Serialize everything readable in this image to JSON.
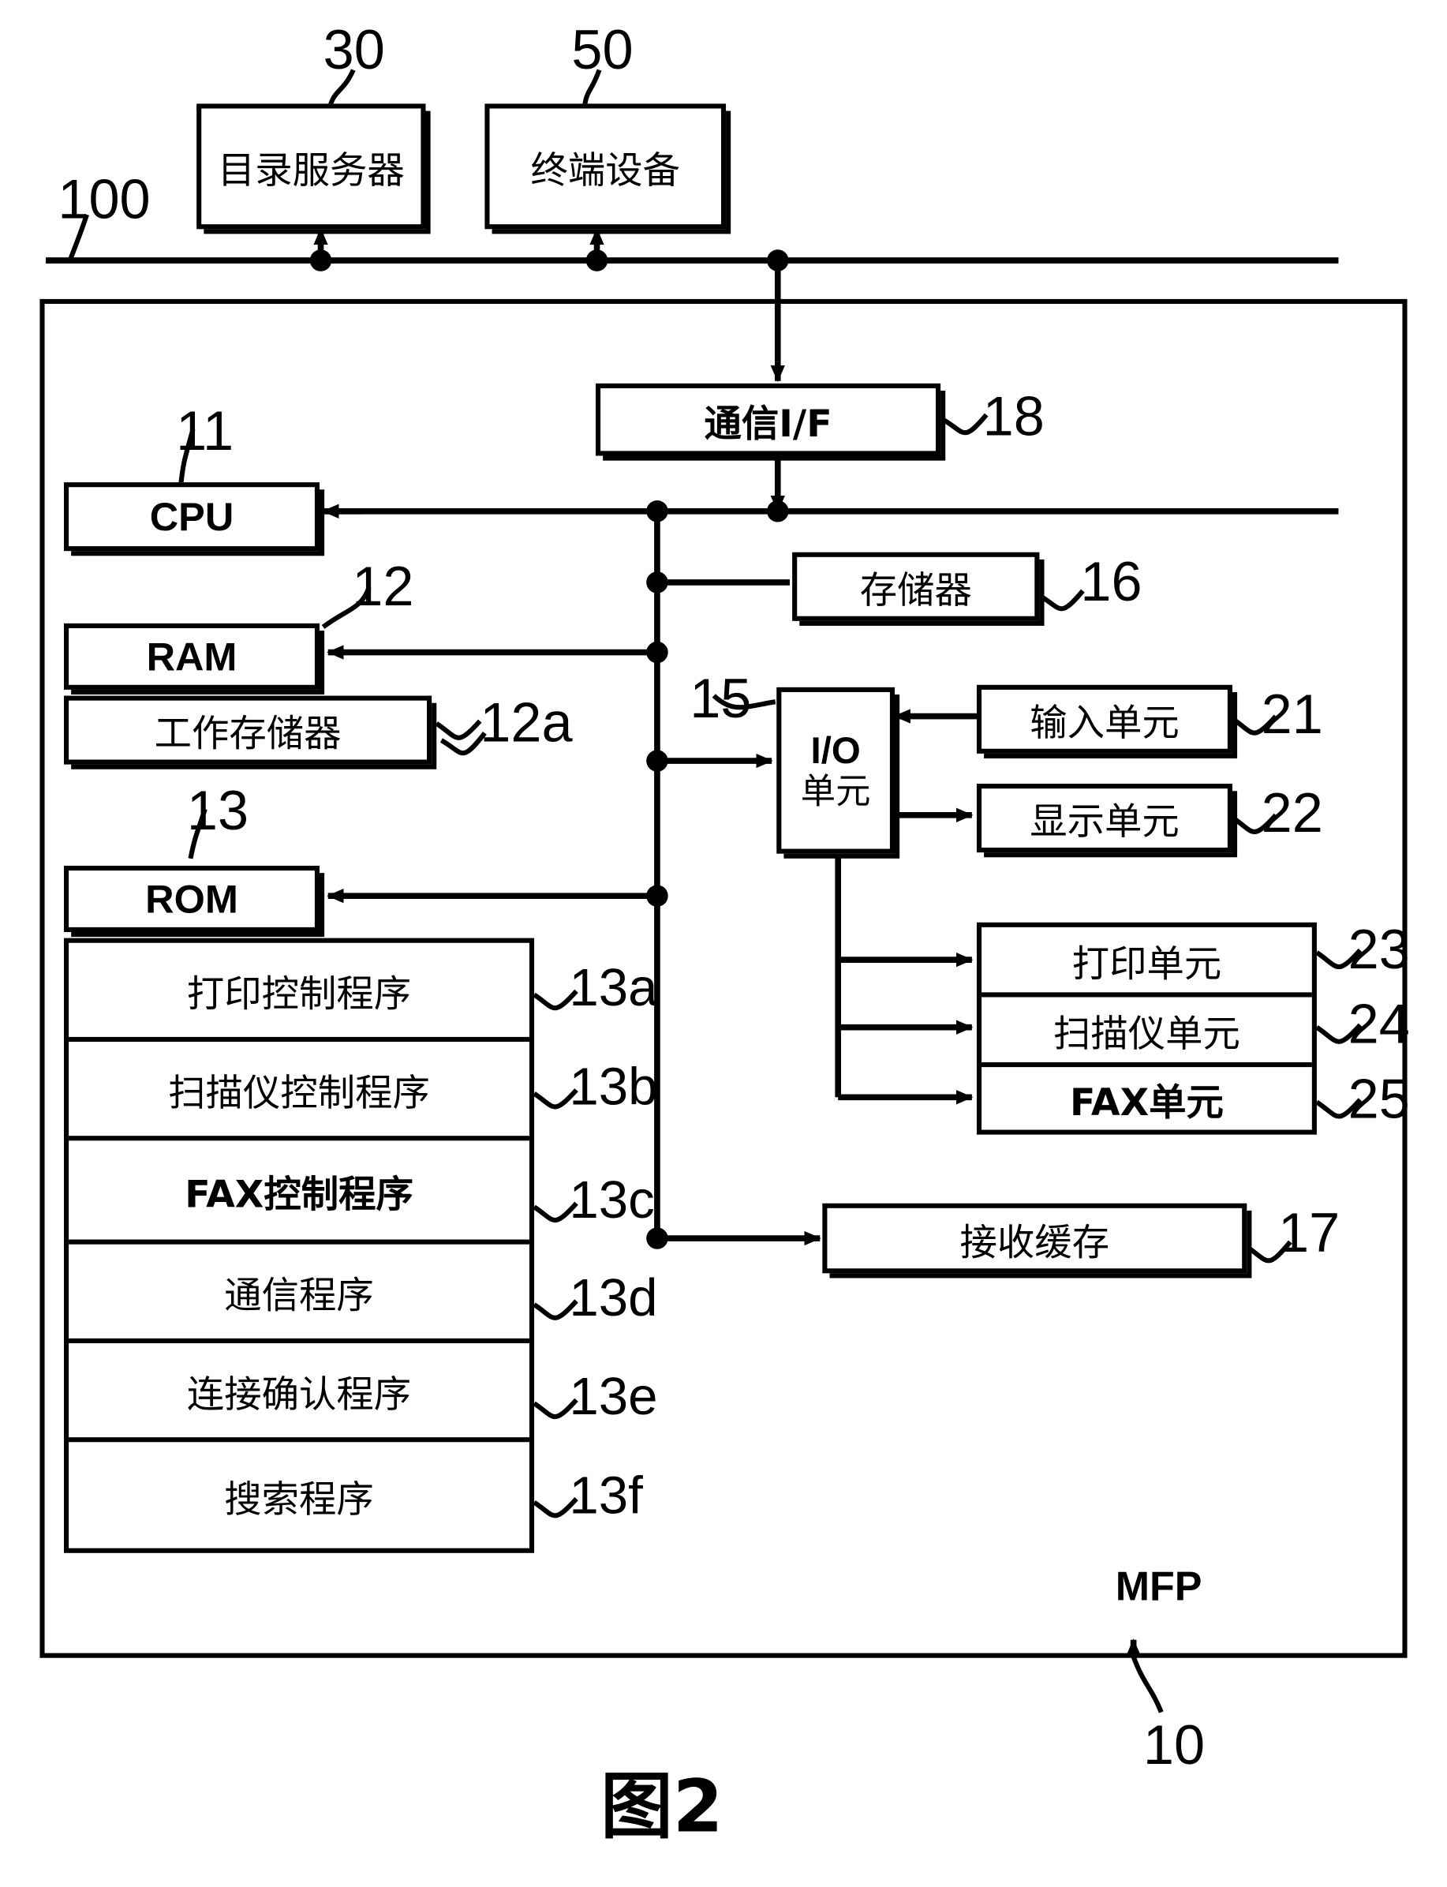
{
  "figure": {
    "caption": "图2",
    "system_label": "100",
    "device_label": "MFP",
    "device_ref": "10"
  },
  "external": {
    "nodes": [
      {
        "label": "目录服务器",
        "ref": "30"
      },
      {
        "label": "终端设备",
        "ref": "50"
      }
    ]
  },
  "mfp": {
    "comm_if": {
      "label": "通信I/F",
      "ref": "18"
    },
    "cpu": {
      "label": "CPU",
      "ref": "11"
    },
    "storage": {
      "label": "存储器",
      "ref": "16"
    },
    "ram": {
      "label": "RAM",
      "ref": "12"
    },
    "work_mem": {
      "label": "工作存储器",
      "ref": "12a"
    },
    "rom": {
      "label": "ROM",
      "ref": "13"
    },
    "io_unit": {
      "label_line1": "I/O",
      "label_line2": "单元",
      "ref": "15"
    },
    "recv_buf": {
      "label": "接收缓存",
      "ref": "17"
    },
    "rom_programs": [
      {
        "label": "打印控制程序",
        "ref": "13a"
      },
      {
        "label": "扫描仪控制程序",
        "ref": "13b"
      },
      {
        "label": "FAX控制程序",
        "ref": "13c",
        "bold": true
      },
      {
        "label": "通信程序",
        "ref": "13d"
      },
      {
        "label": "连接确认程序",
        "ref": "13e"
      },
      {
        "label": "搜索程序",
        "ref": "13f"
      }
    ],
    "io_peripherals": [
      {
        "label": "输入单元",
        "ref": "21"
      },
      {
        "label": "显示单元",
        "ref": "22"
      }
    ],
    "engine_units": [
      {
        "label": "打印单元",
        "ref": "23"
      },
      {
        "label": "扫描仪单元",
        "ref": "24"
      },
      {
        "label": "FAX单元",
        "ref": "25",
        "bold": true
      }
    ]
  },
  "colors": {
    "ink": "#000000",
    "paper": "#ffffff"
  }
}
